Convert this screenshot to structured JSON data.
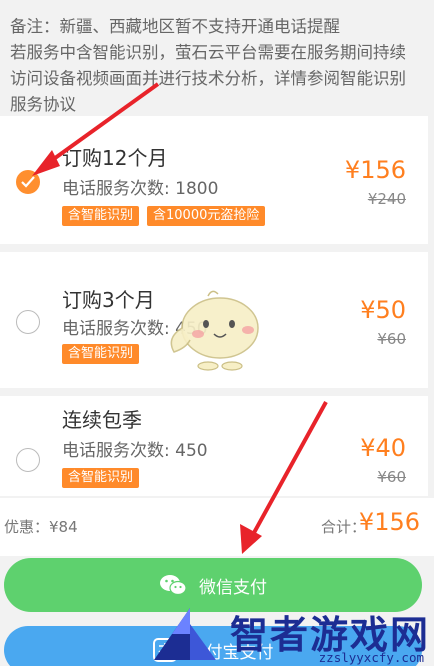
{
  "notice": {
    "line1": "备注：新疆、西藏地区暂不支持开通电话提醒",
    "line2": "若服务中含智能识别，萤石云平台需要在服务期间持续",
    "line3": "访问设备视频画面并进行技术分析，详情参阅智能识别",
    "line4": "服务协议"
  },
  "plans": [
    {
      "title": "订购12个月",
      "sub": "电话服务次数: 1800",
      "tags": [
        "含智能识别",
        "含10000元盗抢险"
      ],
      "price": "¥156",
      "old_price": "¥240",
      "selected": true
    },
    {
      "title": "订购3个月",
      "sub": "电话服务次数: 450",
      "tags": [
        "含智能识别"
      ],
      "price": "¥50",
      "old_price": "¥60",
      "selected": false
    },
    {
      "title": "连续包季",
      "sub": "电话服务次数: 450",
      "tags": [
        "含智能识别"
      ],
      "price": "¥40",
      "old_price": "¥60",
      "selected": false
    }
  ],
  "summary": {
    "discount": "优惠：¥84",
    "total_label": "合计：",
    "total_value": "¥156"
  },
  "buttons": {
    "wechat": "微信支付",
    "alipay": "支付宝支付"
  },
  "watermark": {
    "name": "智者游戏网",
    "url": "zzslyyxcfy.com"
  },
  "colors": {
    "accent": "#ff7f1f",
    "wechat": "#5ed16e",
    "alipay": "#4aa8f0",
    "arrow": "#e8232a"
  }
}
